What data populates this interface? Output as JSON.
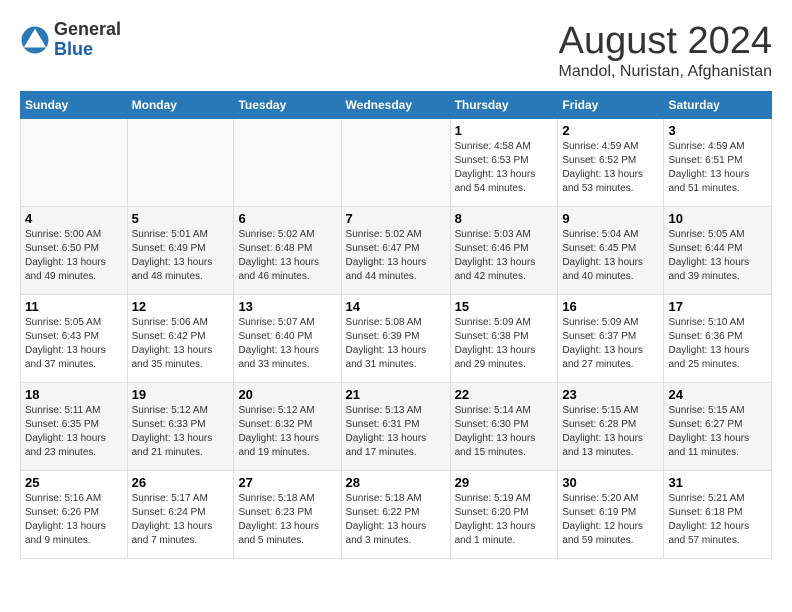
{
  "header": {
    "logo_line1": "General",
    "logo_line2": "Blue",
    "month_title": "August 2024",
    "location": "Mandol, Nuristan, Afghanistan"
  },
  "days_of_week": [
    "Sunday",
    "Monday",
    "Tuesday",
    "Wednesday",
    "Thursday",
    "Friday",
    "Saturday"
  ],
  "weeks": [
    [
      {
        "day": "",
        "content": ""
      },
      {
        "day": "",
        "content": ""
      },
      {
        "day": "",
        "content": ""
      },
      {
        "day": "",
        "content": ""
      },
      {
        "day": "1",
        "content": "Sunrise: 4:58 AM\nSunset: 6:53 PM\nDaylight: 13 hours\nand 54 minutes."
      },
      {
        "day": "2",
        "content": "Sunrise: 4:59 AM\nSunset: 6:52 PM\nDaylight: 13 hours\nand 53 minutes."
      },
      {
        "day": "3",
        "content": "Sunrise: 4:59 AM\nSunset: 6:51 PM\nDaylight: 13 hours\nand 51 minutes."
      }
    ],
    [
      {
        "day": "4",
        "content": "Sunrise: 5:00 AM\nSunset: 6:50 PM\nDaylight: 13 hours\nand 49 minutes."
      },
      {
        "day": "5",
        "content": "Sunrise: 5:01 AM\nSunset: 6:49 PM\nDaylight: 13 hours\nand 48 minutes."
      },
      {
        "day": "6",
        "content": "Sunrise: 5:02 AM\nSunset: 6:48 PM\nDaylight: 13 hours\nand 46 minutes."
      },
      {
        "day": "7",
        "content": "Sunrise: 5:02 AM\nSunset: 6:47 PM\nDaylight: 13 hours\nand 44 minutes."
      },
      {
        "day": "8",
        "content": "Sunrise: 5:03 AM\nSunset: 6:46 PM\nDaylight: 13 hours\nand 42 minutes."
      },
      {
        "day": "9",
        "content": "Sunrise: 5:04 AM\nSunset: 6:45 PM\nDaylight: 13 hours\nand 40 minutes."
      },
      {
        "day": "10",
        "content": "Sunrise: 5:05 AM\nSunset: 6:44 PM\nDaylight: 13 hours\nand 39 minutes."
      }
    ],
    [
      {
        "day": "11",
        "content": "Sunrise: 5:05 AM\nSunset: 6:43 PM\nDaylight: 13 hours\nand 37 minutes."
      },
      {
        "day": "12",
        "content": "Sunrise: 5:06 AM\nSunset: 6:42 PM\nDaylight: 13 hours\nand 35 minutes."
      },
      {
        "day": "13",
        "content": "Sunrise: 5:07 AM\nSunset: 6:40 PM\nDaylight: 13 hours\nand 33 minutes."
      },
      {
        "day": "14",
        "content": "Sunrise: 5:08 AM\nSunset: 6:39 PM\nDaylight: 13 hours\nand 31 minutes."
      },
      {
        "day": "15",
        "content": "Sunrise: 5:09 AM\nSunset: 6:38 PM\nDaylight: 13 hours\nand 29 minutes."
      },
      {
        "day": "16",
        "content": "Sunrise: 5:09 AM\nSunset: 6:37 PM\nDaylight: 13 hours\nand 27 minutes."
      },
      {
        "day": "17",
        "content": "Sunrise: 5:10 AM\nSunset: 6:36 PM\nDaylight: 13 hours\nand 25 minutes."
      }
    ],
    [
      {
        "day": "18",
        "content": "Sunrise: 5:11 AM\nSunset: 6:35 PM\nDaylight: 13 hours\nand 23 minutes."
      },
      {
        "day": "19",
        "content": "Sunrise: 5:12 AM\nSunset: 6:33 PM\nDaylight: 13 hours\nand 21 minutes."
      },
      {
        "day": "20",
        "content": "Sunrise: 5:12 AM\nSunset: 6:32 PM\nDaylight: 13 hours\nand 19 minutes."
      },
      {
        "day": "21",
        "content": "Sunrise: 5:13 AM\nSunset: 6:31 PM\nDaylight: 13 hours\nand 17 minutes."
      },
      {
        "day": "22",
        "content": "Sunrise: 5:14 AM\nSunset: 6:30 PM\nDaylight: 13 hours\nand 15 minutes."
      },
      {
        "day": "23",
        "content": "Sunrise: 5:15 AM\nSunset: 6:28 PM\nDaylight: 13 hours\nand 13 minutes."
      },
      {
        "day": "24",
        "content": "Sunrise: 5:15 AM\nSunset: 6:27 PM\nDaylight: 13 hours\nand 11 minutes."
      }
    ],
    [
      {
        "day": "25",
        "content": "Sunrise: 5:16 AM\nSunset: 6:26 PM\nDaylight: 13 hours\nand 9 minutes."
      },
      {
        "day": "26",
        "content": "Sunrise: 5:17 AM\nSunset: 6:24 PM\nDaylight: 13 hours\nand 7 minutes."
      },
      {
        "day": "27",
        "content": "Sunrise: 5:18 AM\nSunset: 6:23 PM\nDaylight: 13 hours\nand 5 minutes."
      },
      {
        "day": "28",
        "content": "Sunrise: 5:18 AM\nSunset: 6:22 PM\nDaylight: 13 hours\nand 3 minutes."
      },
      {
        "day": "29",
        "content": "Sunrise: 5:19 AM\nSunset: 6:20 PM\nDaylight: 13 hours\nand 1 minute."
      },
      {
        "day": "30",
        "content": "Sunrise: 5:20 AM\nSunset: 6:19 PM\nDaylight: 12 hours\nand 59 minutes."
      },
      {
        "day": "31",
        "content": "Sunrise: 5:21 AM\nSunset: 6:18 PM\nDaylight: 12 hours\nand 57 minutes."
      }
    ]
  ]
}
